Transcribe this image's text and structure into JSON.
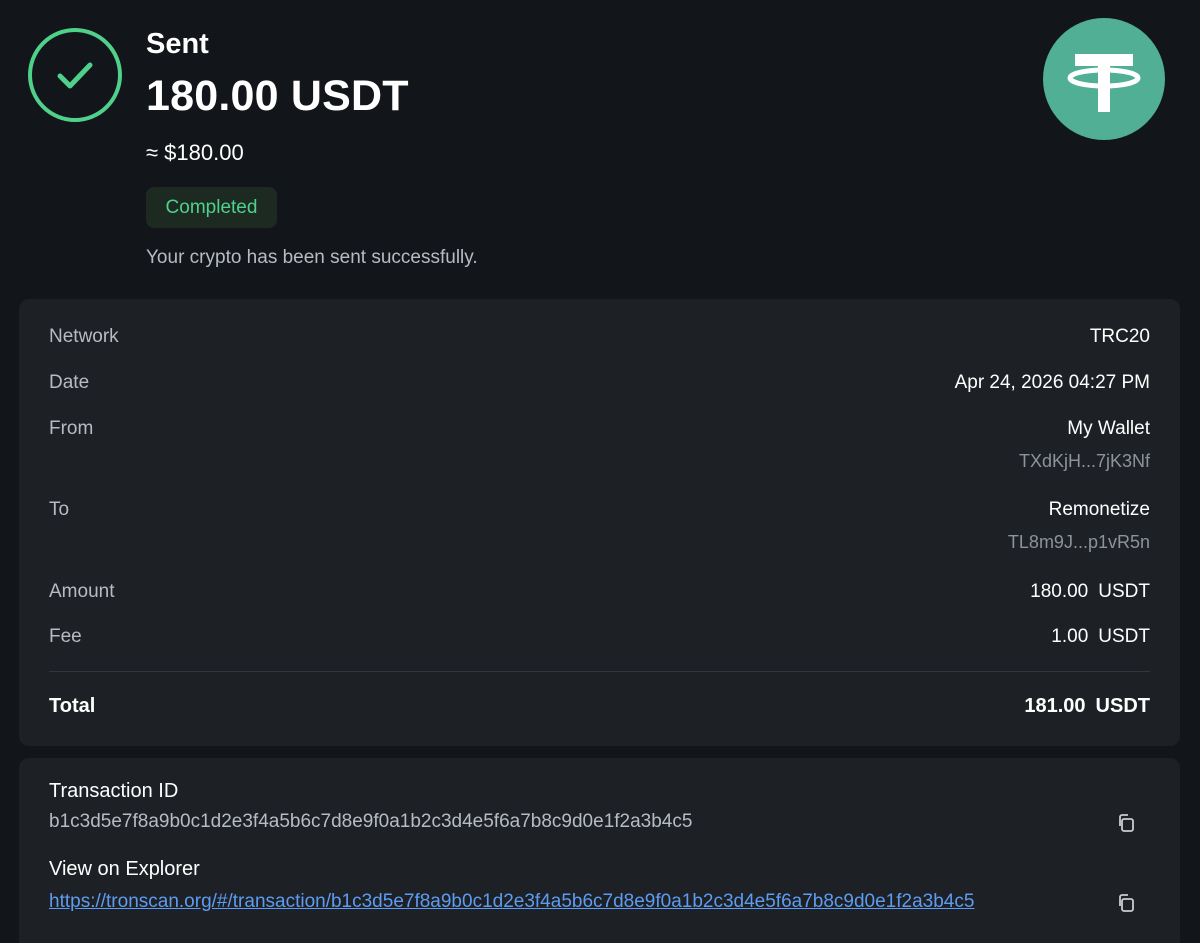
{
  "header": {
    "title": "Sent",
    "amount": "180.00 USDT",
    "fiat": "≈ $180.00",
    "status": "Completed",
    "message": "Your crypto has been sent successfully."
  },
  "details": {
    "network": {
      "label": "Network",
      "value": "TRC20"
    },
    "date": {
      "label": "Date",
      "value": "Apr 24, 2026 04:27 PM"
    },
    "from": {
      "label": "From",
      "name": "My Wallet",
      "address": "TXdKjH...7jK3Nf"
    },
    "to": {
      "label": "To",
      "name": "Remonetize",
      "address": "TL8m9J...p1vR5n"
    },
    "amount": {
      "label": "Amount",
      "value": "180.00",
      "unit": "USDT"
    },
    "fee": {
      "label": "Fee",
      "value": "1.00",
      "unit": "USDT"
    },
    "total": {
      "label": "Total",
      "value": "181.00",
      "unit": "USDT"
    }
  },
  "transaction": {
    "id_label": "Transaction ID",
    "id": "b1c3d5e7f8a9b0c1d2e3f4a5b6c7d8e9f0a1b2c3d4e5f6a7b8c9d0e1f2a3b4c5",
    "explorer_label": "View on Explorer",
    "explorer_url": "https://tronscan.org/#/transaction/b1c3d5e7f8a9b0c1d2e3f4a5b6c7d8e9f0a1b2c3d4e5f6a7b8c9d0e1f2a3b4c5"
  },
  "colors": {
    "success": "#4fd18b",
    "tether": "#50af95",
    "link": "#5d9cf0"
  },
  "icons": {
    "status": "check-circle-icon",
    "token": "tether-logo-icon",
    "copy": "copy-icon"
  }
}
